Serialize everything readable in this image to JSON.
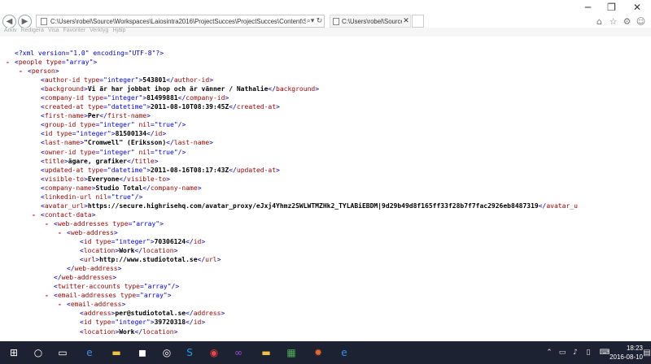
{
  "browser": {
    "address_url": "C:\\Users\\robel\\Source\\Workspaces\\Laiosintra2016\\ProjectSucces\\ProjectSucces\\Content\\Static\\",
    "tab_title": "C:\\Users\\robel\\Source\\Works...",
    "window_controls": [
      "minimize-icon",
      "restore-icon",
      "close-icon"
    ],
    "menu": [
      "Arkiv",
      "Redigera",
      "Visa",
      "Favoriter",
      "Verktyg",
      "Hjälp"
    ]
  },
  "xml": {
    "declaration": "<?xml version=\"1.0\" encoding=\"UTF-8\"?>",
    "lines": [
      {
        "indent": 0,
        "toggle": "-",
        "parts": [
          [
            "b",
            "<"
          ],
          [
            "t",
            "people"
          ],
          [
            "a",
            " type"
          ],
          [
            "b",
            "=\""
          ],
          [
            "v",
            "array"
          ],
          [
            "b",
            "\">"
          ]
        ]
      },
      {
        "indent": 1,
        "toggle": "-",
        "parts": [
          [
            "b",
            "<"
          ],
          [
            "t",
            "person"
          ],
          [
            "b",
            ">"
          ]
        ]
      },
      {
        "indent": 2,
        "parts": [
          [
            "b",
            "<"
          ],
          [
            "t",
            "author-id"
          ],
          [
            "a",
            " type"
          ],
          [
            "b",
            "=\""
          ],
          [
            "v",
            "integer"
          ],
          [
            "b",
            "\">"
          ],
          [
            "x",
            "543801"
          ],
          [
            "b",
            "</"
          ],
          [
            "t",
            "author-id"
          ],
          [
            "b",
            ">"
          ]
        ]
      },
      {
        "indent": 2,
        "parts": [
          [
            "b",
            "<"
          ],
          [
            "t",
            "background"
          ],
          [
            "b",
            ">"
          ],
          [
            "x",
            "Vi är har jobbat ihop och är vänner / Nathalie"
          ],
          [
            "b",
            "</"
          ],
          [
            "t",
            "background"
          ],
          [
            "b",
            ">"
          ]
        ]
      },
      {
        "indent": 2,
        "parts": [
          [
            "b",
            "<"
          ],
          [
            "t",
            "company-id"
          ],
          [
            "a",
            " type"
          ],
          [
            "b",
            "=\""
          ],
          [
            "v",
            "integer"
          ],
          [
            "b",
            "\">"
          ],
          [
            "x",
            "81499881"
          ],
          [
            "b",
            "</"
          ],
          [
            "t",
            "company-id"
          ],
          [
            "b",
            ">"
          ]
        ]
      },
      {
        "indent": 2,
        "parts": [
          [
            "b",
            "<"
          ],
          [
            "t",
            "created-at"
          ],
          [
            "a",
            " type"
          ],
          [
            "b",
            "=\""
          ],
          [
            "v",
            "datetime"
          ],
          [
            "b",
            "\">"
          ],
          [
            "x",
            "2011-08-10T08:39:45Z"
          ],
          [
            "b",
            "</"
          ],
          [
            "t",
            "created-at"
          ],
          [
            "b",
            ">"
          ]
        ]
      },
      {
        "indent": 2,
        "parts": [
          [
            "b",
            "<"
          ],
          [
            "t",
            "first-name"
          ],
          [
            "b",
            ">"
          ],
          [
            "x",
            "Per"
          ],
          [
            "b",
            "</"
          ],
          [
            "t",
            "first-name"
          ],
          [
            "b",
            ">"
          ]
        ]
      },
      {
        "indent": 2,
        "parts": [
          [
            "b",
            "<"
          ],
          [
            "t",
            "group-id"
          ],
          [
            "a",
            " type"
          ],
          [
            "b",
            "=\""
          ],
          [
            "v",
            "integer"
          ],
          [
            "b",
            "\""
          ],
          [
            "a",
            " nil"
          ],
          [
            "b",
            "=\""
          ],
          [
            "v",
            "true"
          ],
          [
            "b",
            "\"/>"
          ]
        ]
      },
      {
        "indent": 2,
        "parts": [
          [
            "b",
            "<"
          ],
          [
            "t",
            "id"
          ],
          [
            "a",
            " type"
          ],
          [
            "b",
            "=\""
          ],
          [
            "v",
            "integer"
          ],
          [
            "b",
            "\">"
          ],
          [
            "x",
            "81500134"
          ],
          [
            "b",
            "</"
          ],
          [
            "t",
            "id"
          ],
          [
            "b",
            ">"
          ]
        ]
      },
      {
        "indent": 2,
        "parts": [
          [
            "b",
            "<"
          ],
          [
            "t",
            "last-name"
          ],
          [
            "b",
            ">"
          ],
          [
            "x",
            "\"Cromwell\" (Eriksson)"
          ],
          [
            "b",
            "</"
          ],
          [
            "t",
            "last-name"
          ],
          [
            "b",
            ">"
          ]
        ]
      },
      {
        "indent": 2,
        "parts": [
          [
            "b",
            "<"
          ],
          [
            "t",
            "owner-id"
          ],
          [
            "a",
            " type"
          ],
          [
            "b",
            "=\""
          ],
          [
            "v",
            "integer"
          ],
          [
            "b",
            "\""
          ],
          [
            "a",
            " nil"
          ],
          [
            "b",
            "=\""
          ],
          [
            "v",
            "true"
          ],
          [
            "b",
            "\"/>"
          ]
        ]
      },
      {
        "indent": 2,
        "parts": [
          [
            "b",
            "<"
          ],
          [
            "t",
            "title"
          ],
          [
            "b",
            ">"
          ],
          [
            "x",
            "ägare, grafiker"
          ],
          [
            "b",
            "</"
          ],
          [
            "t",
            "title"
          ],
          [
            "b",
            ">"
          ]
        ]
      },
      {
        "indent": 2,
        "parts": [
          [
            "b",
            "<"
          ],
          [
            "t",
            "updated-at"
          ],
          [
            "a",
            " type"
          ],
          [
            "b",
            "=\""
          ],
          [
            "v",
            "datetime"
          ],
          [
            "b",
            "\">"
          ],
          [
            "x",
            "2011-08-16T08:17:43Z"
          ],
          [
            "b",
            "</"
          ],
          [
            "t",
            "updated-at"
          ],
          [
            "b",
            ">"
          ]
        ]
      },
      {
        "indent": 2,
        "parts": [
          [
            "b",
            "<"
          ],
          [
            "t",
            "visible-to"
          ],
          [
            "b",
            ">"
          ],
          [
            "x",
            "Everyone"
          ],
          [
            "b",
            "</"
          ],
          [
            "t",
            "visible-to"
          ],
          [
            "b",
            ">"
          ]
        ]
      },
      {
        "indent": 2,
        "parts": [
          [
            "b",
            "<"
          ],
          [
            "t",
            "company-name"
          ],
          [
            "b",
            ">"
          ],
          [
            "x",
            "Studio Total"
          ],
          [
            "b",
            "</"
          ],
          [
            "t",
            "company-name"
          ],
          [
            "b",
            ">"
          ]
        ]
      },
      {
        "indent": 2,
        "parts": [
          [
            "b",
            "<"
          ],
          [
            "t",
            "linkedin-url"
          ],
          [
            "a",
            " nil"
          ],
          [
            "b",
            "=\""
          ],
          [
            "v",
            "true"
          ],
          [
            "b",
            "\"/>"
          ]
        ]
      },
      {
        "indent": 2,
        "parts": [
          [
            "b",
            "<"
          ],
          [
            "t",
            "avatar_url"
          ],
          [
            "b",
            ">"
          ],
          [
            "x",
            "https://secure.highrisehq.com/avatar_proxy/eJxj4Yhmz2SWLWTMZHk2_TYLABiEBDM|9d29b49d8f165ff33f28b7f7fac2926eb8487319"
          ],
          [
            "b",
            "</"
          ],
          [
            "t",
            "avatar_u"
          ]
        ]
      },
      {
        "indent": 2,
        "toggle": "-",
        "parts": [
          [
            "b",
            "<"
          ],
          [
            "t",
            "contact-data"
          ],
          [
            "b",
            ">"
          ]
        ]
      },
      {
        "indent": 3,
        "toggle": "-",
        "parts": [
          [
            "b",
            "<"
          ],
          [
            "t",
            "web-addresses"
          ],
          [
            "a",
            " type"
          ],
          [
            "b",
            "=\""
          ],
          [
            "v",
            "array"
          ],
          [
            "b",
            "\">"
          ]
        ]
      },
      {
        "indent": 4,
        "toggle": "-",
        "parts": [
          [
            "b",
            "<"
          ],
          [
            "t",
            "web-address"
          ],
          [
            "b",
            ">"
          ]
        ]
      },
      {
        "indent": 5,
        "parts": [
          [
            "b",
            "<"
          ],
          [
            "t",
            "id"
          ],
          [
            "a",
            " type"
          ],
          [
            "b",
            "=\""
          ],
          [
            "v",
            "integer"
          ],
          [
            "b",
            "\">"
          ],
          [
            "x",
            "70306124"
          ],
          [
            "b",
            "</"
          ],
          [
            "t",
            "id"
          ],
          [
            "b",
            ">"
          ]
        ]
      },
      {
        "indent": 5,
        "parts": [
          [
            "b",
            "<"
          ],
          [
            "t",
            "location"
          ],
          [
            "b",
            ">"
          ],
          [
            "x",
            "Work"
          ],
          [
            "b",
            "</"
          ],
          [
            "t",
            "location"
          ],
          [
            "b",
            ">"
          ]
        ]
      },
      {
        "indent": 5,
        "parts": [
          [
            "b",
            "<"
          ],
          [
            "t",
            "url"
          ],
          [
            "b",
            ">"
          ],
          [
            "x",
            "http://www.studiototal.se"
          ],
          [
            "b",
            "</"
          ],
          [
            "t",
            "url"
          ],
          [
            "b",
            ">"
          ]
        ]
      },
      {
        "indent": 4,
        "parts": [
          [
            "b",
            "</"
          ],
          [
            "t",
            "web-address"
          ],
          [
            "b",
            ">"
          ]
        ]
      },
      {
        "indent": 3,
        "parts": [
          [
            "b",
            "</"
          ],
          [
            "t",
            "web-addresses"
          ],
          [
            "b",
            ">"
          ]
        ]
      },
      {
        "indent": 3,
        "parts": [
          [
            "b",
            "<"
          ],
          [
            "t",
            "twitter-accounts"
          ],
          [
            "a",
            " type"
          ],
          [
            "b",
            "=\""
          ],
          [
            "v",
            "array"
          ],
          [
            "b",
            "\"/>"
          ]
        ]
      },
      {
        "indent": 3,
        "toggle": "-",
        "parts": [
          [
            "b",
            "<"
          ],
          [
            "t",
            "email-addresses"
          ],
          [
            "a",
            " type"
          ],
          [
            "b",
            "=\""
          ],
          [
            "v",
            "array"
          ],
          [
            "b",
            "\">"
          ]
        ]
      },
      {
        "indent": 4,
        "toggle": "-",
        "parts": [
          [
            "b",
            "<"
          ],
          [
            "t",
            "email-address"
          ],
          [
            "b",
            ">"
          ]
        ]
      },
      {
        "indent": 5,
        "parts": [
          [
            "b",
            "<"
          ],
          [
            "t",
            "address"
          ],
          [
            "b",
            ">"
          ],
          [
            "x",
            "per@studiototal.se"
          ],
          [
            "b",
            "</"
          ],
          [
            "t",
            "address"
          ],
          [
            "b",
            ">"
          ]
        ]
      },
      {
        "indent": 5,
        "parts": [
          [
            "b",
            "<"
          ],
          [
            "t",
            "id"
          ],
          [
            "a",
            " type"
          ],
          [
            "b",
            "=\""
          ],
          [
            "v",
            "integer"
          ],
          [
            "b",
            "\">"
          ],
          [
            "x",
            "39720318"
          ],
          [
            "b",
            "</"
          ],
          [
            "t",
            "id"
          ],
          [
            "b",
            ">"
          ]
        ]
      },
      {
        "indent": 5,
        "parts": [
          [
            "b",
            "<"
          ],
          [
            "t",
            "location"
          ],
          [
            "b",
            ">"
          ],
          [
            "x",
            "Work"
          ],
          [
            "b",
            "</"
          ],
          [
            "t",
            "location"
          ],
          [
            "b",
            ">"
          ]
        ]
      },
      {
        "indent": 4,
        "parts": [
          [
            "b",
            "</"
          ],
          [
            "t",
            "email-address"
          ],
          [
            "b",
            ">"
          ]
        ]
      },
      {
        "indent": 3,
        "parts": [
          [
            "b",
            "</"
          ],
          [
            "t",
            "email-addresses"
          ],
          [
            "b",
            ">"
          ]
        ]
      },
      {
        "indent": 3,
        "parts": [
          [
            "b",
            "<"
          ],
          [
            "t",
            "addresses"
          ],
          [
            "a",
            " type"
          ],
          [
            "b",
            "=\""
          ],
          [
            "v",
            "array"
          ],
          [
            "b",
            "\"/>"
          ]
        ]
      }
    ]
  },
  "taskbar": {
    "apps": [
      "windows-start-icon",
      "search-icon",
      "task-view-icon",
      "edge-icon",
      "file-explorer-icon",
      "store-icon",
      "photos-icon",
      "chrome-icon",
      "skype-icon",
      "chrome-icon",
      "visual-studio-icon",
      "folder-icon",
      "app-icon",
      "app-icon",
      "internet-explorer-icon"
    ],
    "clock_time": "18:23",
    "clock_date": "2016-08-10",
    "notification_icon": "notification-icon"
  }
}
